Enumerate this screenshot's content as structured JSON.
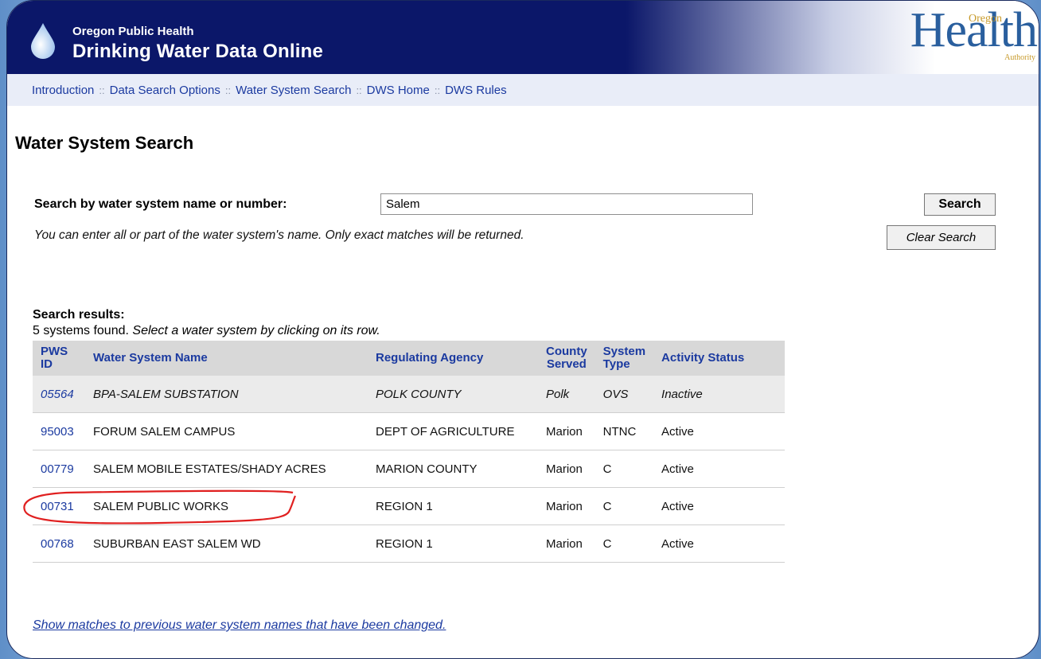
{
  "brand": {
    "subtitle": "Oregon Public Health",
    "title": "Drinking Water Data Online"
  },
  "logo": {
    "main": "Health",
    "top": "Oregon",
    "bottom": "Authority"
  },
  "nav": [
    {
      "label": "Introduction"
    },
    {
      "label": "Data Search Options"
    },
    {
      "label": "Water System Search"
    },
    {
      "label": "DWS Home"
    },
    {
      "label": "DWS Rules"
    }
  ],
  "nav_separator": "::",
  "page_title": "Water System Search",
  "search": {
    "label": "Search by water system name or number:",
    "value": "Salem",
    "hint": "You can enter all or part of the water system's name. Only exact matches will be returned.",
    "search_button": "Search",
    "clear_button": "Clear Search"
  },
  "results": {
    "label": "Search results:",
    "count_text": "5 systems found.",
    "instruction": "Select a water system by clicking on its row.",
    "columns": [
      "PWS ID",
      "Water System Name",
      "Regulating Agency",
      "County Served",
      "System Type",
      "Activity Status"
    ],
    "rows": [
      {
        "pws_id": "05564",
        "name": "BPA-SALEM SUBSTATION",
        "agency": "POLK COUNTY",
        "county": "Polk",
        "type": "OVS",
        "status": "Inactive"
      },
      {
        "pws_id": "95003",
        "name": "FORUM SALEM CAMPUS",
        "agency": "DEPT OF AGRICULTURE",
        "county": "Marion",
        "type": "NTNC",
        "status": "Active"
      },
      {
        "pws_id": "00779",
        "name": "SALEM MOBILE ESTATES/SHADY ACRES",
        "agency": "MARION COUNTY",
        "county": "Marion",
        "type": "C",
        "status": "Active"
      },
      {
        "pws_id": "00731",
        "name": "SALEM PUBLIC WORKS",
        "agency": "REGION 1",
        "county": "Marion",
        "type": "C",
        "status": "Active"
      },
      {
        "pws_id": "00768",
        "name": "SUBURBAN EAST SALEM WD",
        "agency": "REGION 1",
        "county": "Marion",
        "type": "C",
        "status": "Active"
      }
    ]
  },
  "previous_names_link": "Show matches to previous water system names that have been changed.",
  "colors": {
    "banner": "#0b1769",
    "link": "#1b3aa0",
    "annotation": "#e02020"
  }
}
